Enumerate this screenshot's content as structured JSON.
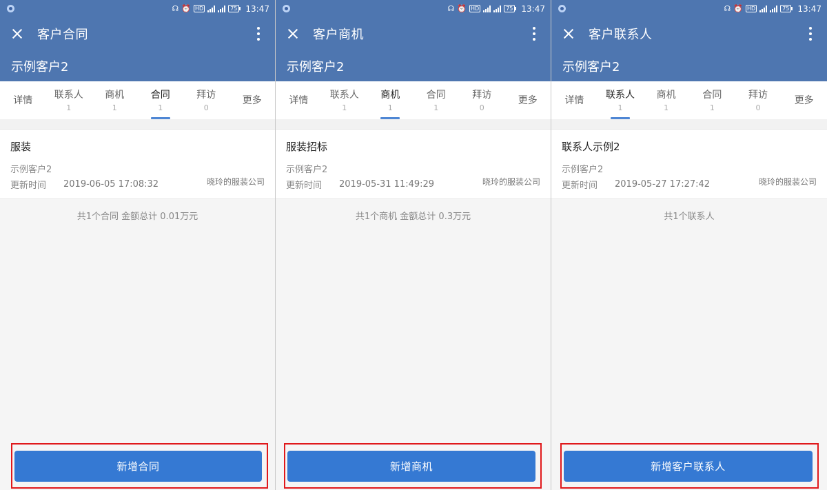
{
  "status": {
    "time": "13:47",
    "battery": "75"
  },
  "screens": [
    {
      "title": "客户合同",
      "customer": "示例客户2",
      "tabs": [
        {
          "label": "详情",
          "count": ""
        },
        {
          "label": "联系人",
          "count": "1"
        },
        {
          "label": "商机",
          "count": "1"
        },
        {
          "label": "合同",
          "count": "1"
        },
        {
          "label": "拜访",
          "count": "0"
        },
        {
          "label": "更多",
          "count": ""
        }
      ],
      "active_tab": 3,
      "card": {
        "title": "服装",
        "subtitle": "示例客户2",
        "update_label": "更新时间",
        "update_time": "2019-06-05 17:08:32",
        "company": "晓玲的服装公司"
      },
      "summary": "共1个合同 金额总计 0.01万元",
      "button": "新增合同"
    },
    {
      "title": "客户商机",
      "customer": "示例客户2",
      "tabs": [
        {
          "label": "详情",
          "count": ""
        },
        {
          "label": "联系人",
          "count": "1"
        },
        {
          "label": "商机",
          "count": "1"
        },
        {
          "label": "合同",
          "count": "1"
        },
        {
          "label": "拜访",
          "count": "0"
        },
        {
          "label": "更多",
          "count": ""
        }
      ],
      "active_tab": 2,
      "card": {
        "title": "服装招标",
        "subtitle": "示例客户2",
        "update_label": "更新时间",
        "update_time": "2019-05-31 11:49:29",
        "company": "晓玲的服装公司"
      },
      "summary": "共1个商机 金额总计 0.3万元",
      "button": "新增商机"
    },
    {
      "title": "客户联系人",
      "customer": "示例客户2",
      "tabs": [
        {
          "label": "详情",
          "count": ""
        },
        {
          "label": "联系人",
          "count": "1"
        },
        {
          "label": "商机",
          "count": "1"
        },
        {
          "label": "合同",
          "count": "1"
        },
        {
          "label": "拜访",
          "count": "0"
        },
        {
          "label": "更多",
          "count": ""
        }
      ],
      "active_tab": 1,
      "card": {
        "title": "联系人示例2",
        "subtitle": "示例客户2",
        "update_label": "更新时间",
        "update_time": "2019-05-27 17:27:42",
        "company": "晓玲的服装公司"
      },
      "summary": "共1个联系人",
      "button": "新增客户联系人"
    }
  ]
}
